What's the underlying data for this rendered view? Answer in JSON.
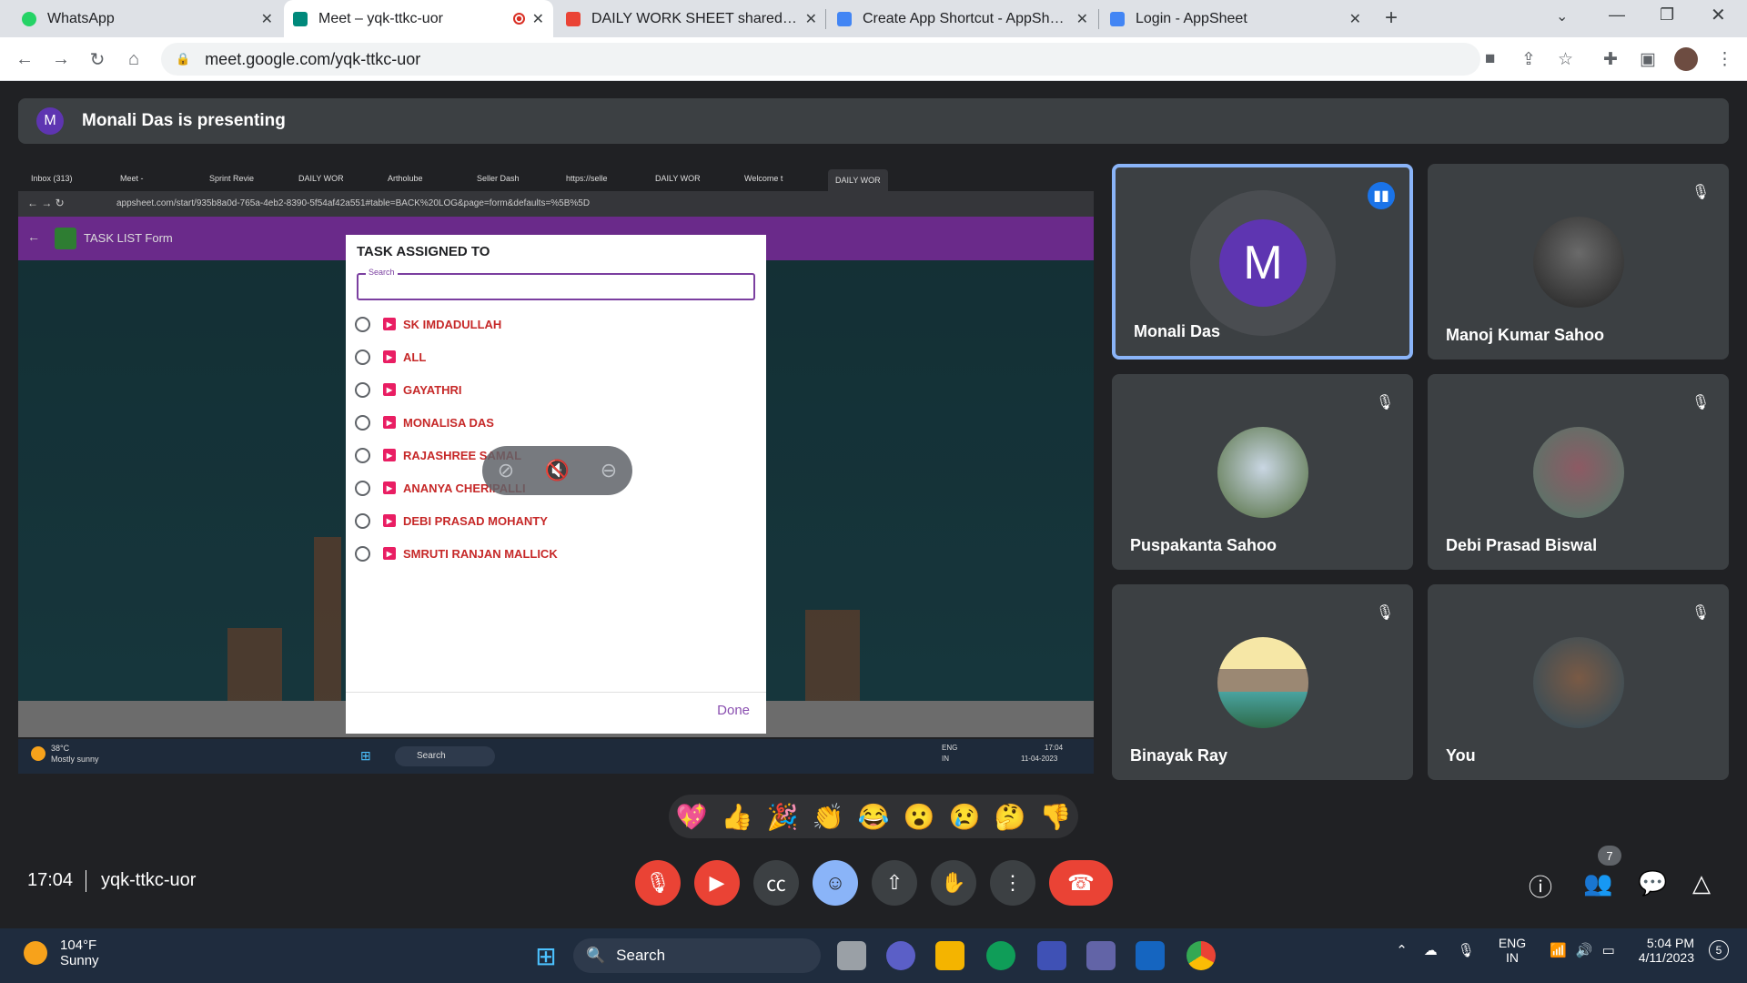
{
  "browser": {
    "tabs": [
      {
        "title": "WhatsApp",
        "favicon_color": "#25d366"
      },
      {
        "title": "Meet – yqk-ttkc-uor",
        "favicon_color": "#00897b"
      },
      {
        "title": "DAILY WORK SHEET shared by m",
        "favicon_color": "#ea4335"
      },
      {
        "title": "Create App Shortcut - AppSheet",
        "favicon_color": "#4285f4"
      },
      {
        "title": "Login - AppSheet",
        "favicon_color": "#4285f4"
      }
    ],
    "new_tab": "+",
    "url": "meet.google.com/yqk-ttkc-uor"
  },
  "meet": {
    "presenting_initial": "M",
    "presenting_text": "Monali Das is presenting",
    "time": "17:04",
    "meeting_code": "yqk-ttkc-uor",
    "people_count": "7",
    "reactions": [
      "💖",
      "👍",
      "🎉",
      "👏",
      "😂",
      "😮",
      "😢",
      "🤔",
      "👎"
    ]
  },
  "shared_screen": {
    "tabs": [
      "Inbox (313)",
      "Meet -",
      "Sprint Revie",
      "DAILY WOR",
      "Artholube",
      "Seller Dash",
      "https://selle",
      "DAILY WOR",
      "Welcome t",
      "DAILY WOR"
    ],
    "url": "appsheet.com/start/935b8a0d-765a-4eb2-8390-5f54af42a551#table=BACK%20LOG&page=form&defaults=%5B%5D",
    "app_title": "TASK LIST Form",
    "dialog": {
      "title": "TASK ASSIGNED TO",
      "search_label": "Search",
      "options": [
        "SK IMDADULLAH",
        "ALL",
        "GAYATHRI",
        "MONALISA DAS",
        "RAJASHREE SAMAL",
        "ANANYA CHERIPALLI",
        "DEBI PRASAD MOHANTY",
        "SMRUTI RANJAN MALLICK"
      ],
      "done": "Done"
    },
    "taskbar": {
      "temp": "38°C",
      "weather": "Mostly sunny",
      "search": "Search",
      "lang1": "ENG",
      "lang2": "IN",
      "time": "17:04",
      "date": "11-04-2023"
    }
  },
  "participants": [
    {
      "name": "Monali Das",
      "initial": "M",
      "speaking": true
    },
    {
      "name": "Manoj Kumar Sahoo",
      "speaking": false
    },
    {
      "name": "Puspakanta Sahoo",
      "speaking": false
    },
    {
      "name": "Debi Prasad Biswal",
      "speaking": false
    },
    {
      "name": "Binayak Ray",
      "speaking": false
    },
    {
      "name": "You",
      "speaking": false
    }
  ],
  "taskbar": {
    "temp": "104°F",
    "weather": "Sunny",
    "search": "Search",
    "lang1": "ENG",
    "lang2": "IN",
    "time": "5:04 PM",
    "date": "4/11/2023",
    "notification_count": "5"
  }
}
